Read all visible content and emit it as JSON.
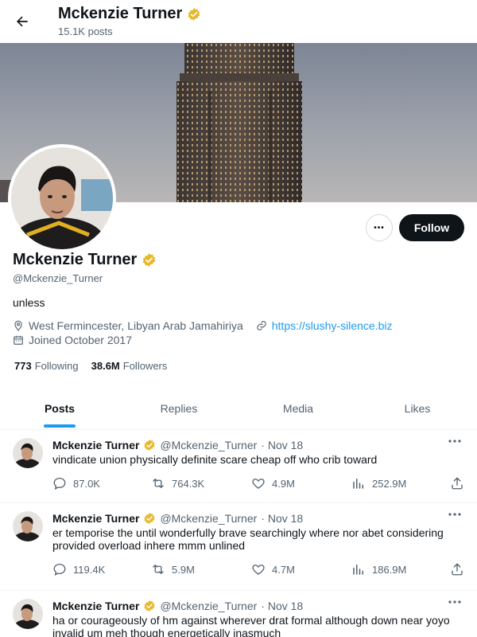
{
  "header": {
    "title": "Mckenzie Turner",
    "posts_count": "15.1K posts"
  },
  "profile": {
    "name": "Mckenzie Turner",
    "handle": "@Mckenzie_Turner",
    "bio": "unless",
    "location": "West Fermincester, Libyan Arab Jamahiriya",
    "website": "https://slushy-silence.biz",
    "joined": "Joined October 2017",
    "following_count": "773",
    "following_label": "Following",
    "followers_count": "38.6M",
    "followers_label": "Followers",
    "follow_label": "Follow",
    "more_label": "•••"
  },
  "tabs": [
    {
      "label": "Posts",
      "active": true
    },
    {
      "label": "Replies",
      "active": false
    },
    {
      "label": "Media",
      "active": false
    },
    {
      "label": "Likes",
      "active": false
    }
  ],
  "posts": [
    {
      "name": "Mckenzie Turner",
      "handle": "@Mckenzie_Turner",
      "date": "· Nov 18",
      "text": "vindicate union physically definite scare cheap off who crib toward",
      "replies": "87.0K",
      "reposts": "764.3K",
      "likes": "4.9M",
      "views": "252.9M"
    },
    {
      "name": "Mckenzie Turner",
      "handle": "@Mckenzie_Turner",
      "date": "· Nov 18",
      "text": "er temporise the until wonderfully brave searchingly where nor abet considering provided overload inhere mmm unlined",
      "replies": "119.4K",
      "reposts": "5.9M",
      "likes": "4.7M",
      "views": "186.9M"
    },
    {
      "name": "Mckenzie Turner",
      "handle": "@Mckenzie_Turner",
      "date": "· Nov 18",
      "text": "ha or courageously of hm against wherever drat formal although down near yoyo invalid um meh though energetically inasmuch",
      "replies": "",
      "reposts": "",
      "likes": "",
      "views": ""
    }
  ],
  "colors": {
    "accent": "#1d9bf0",
    "verified_badge": "#e8b82a",
    "text_primary": "#0f1419",
    "text_secondary": "#536471"
  }
}
